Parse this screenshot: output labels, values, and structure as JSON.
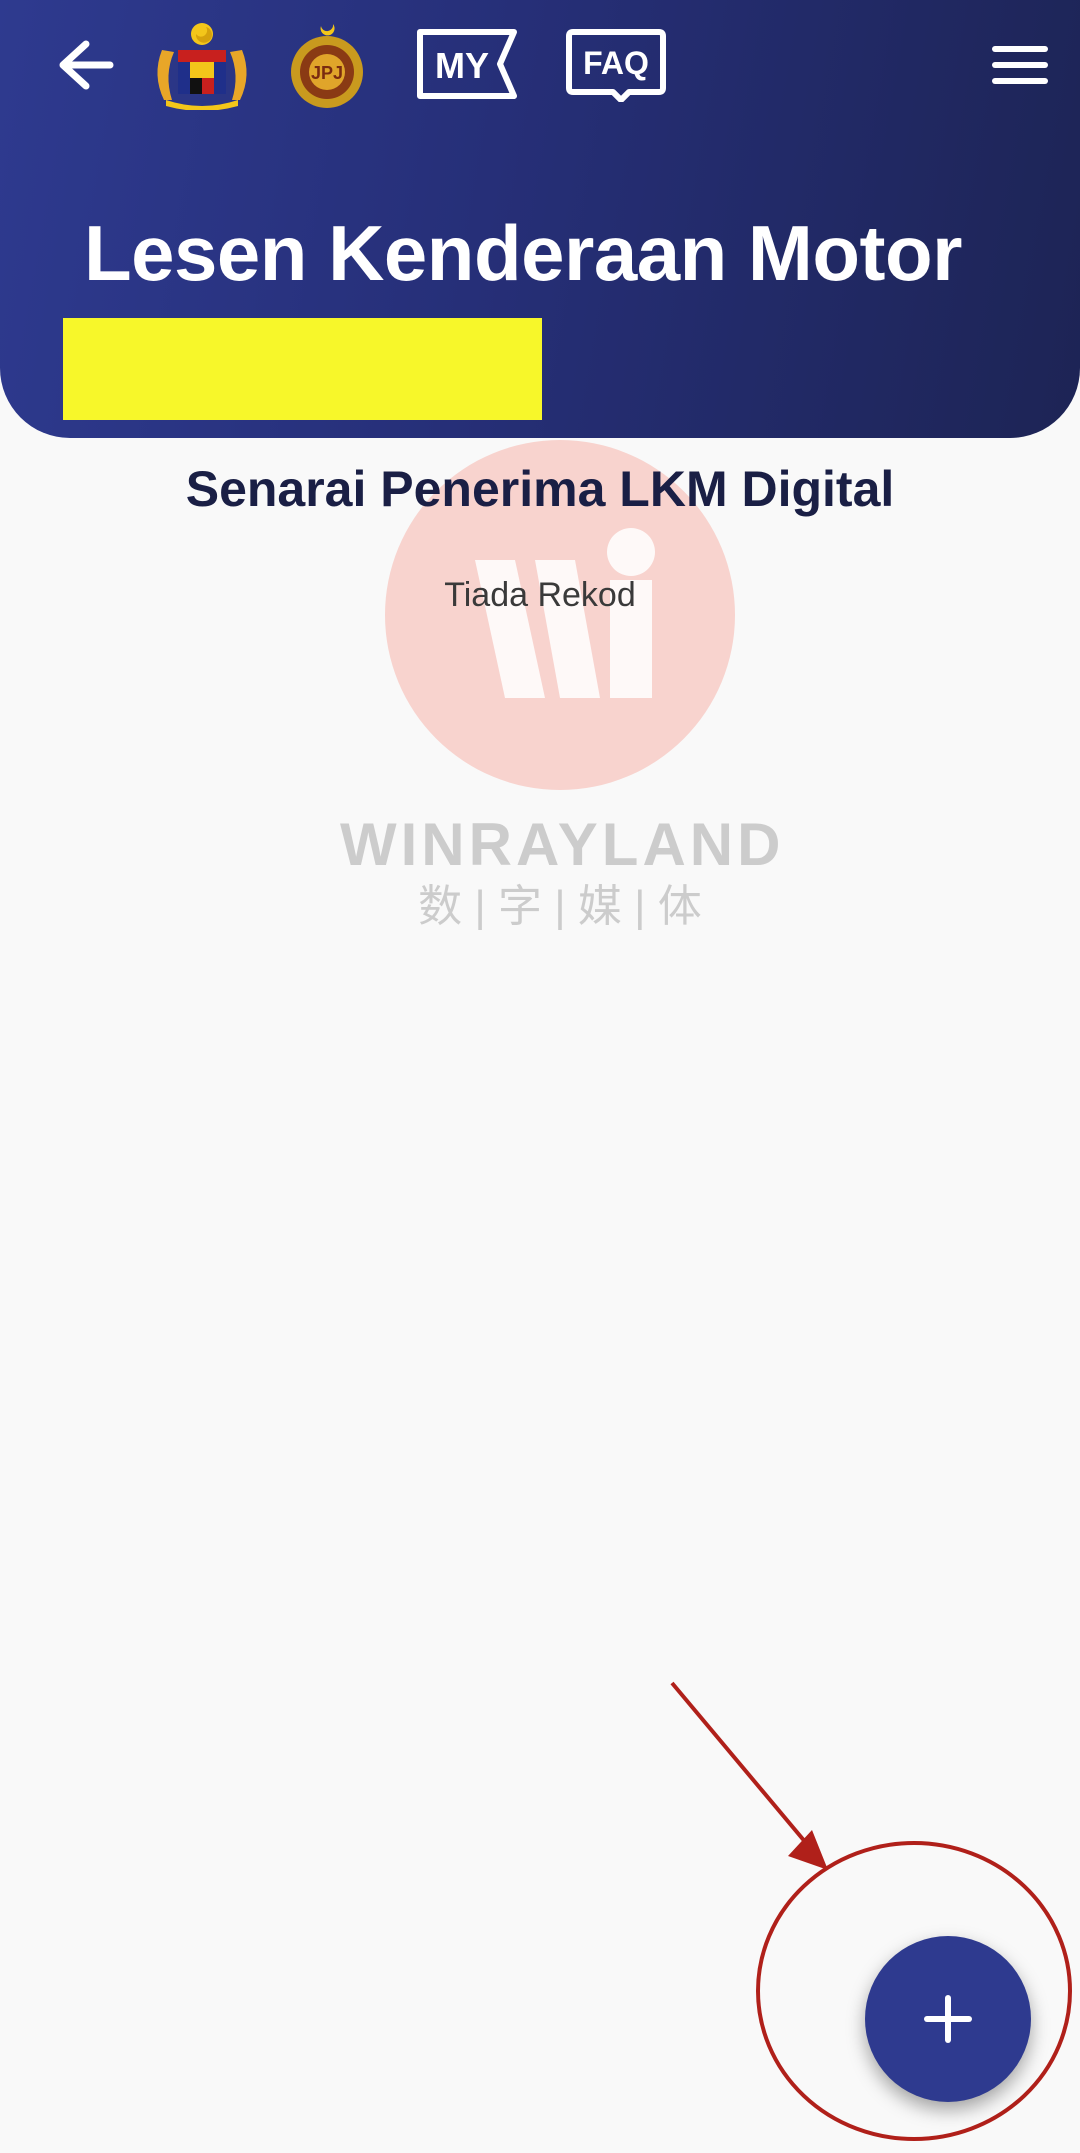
{
  "header": {
    "title": "Lesen Kenderaan Motor",
    "my_label": "MY",
    "faq_label": "FAQ",
    "emblem_icon": "malaysia-coat-of-arms-icon",
    "jpj_icon": "jpj-emblem-icon"
  },
  "content": {
    "section_title": "Senarai Penerima LKM Digital",
    "empty_text": "Tiada Rekod"
  },
  "watermark": {
    "word": "WINRAYLAND",
    "sub": "数 | 字 | 媒 | 体"
  },
  "colors": {
    "header_start": "#2e3a8f",
    "header_end": "#1d2455",
    "fab": "#2e3a8f",
    "redaction": "#f7f72a",
    "annotation": "#b0201a"
  }
}
